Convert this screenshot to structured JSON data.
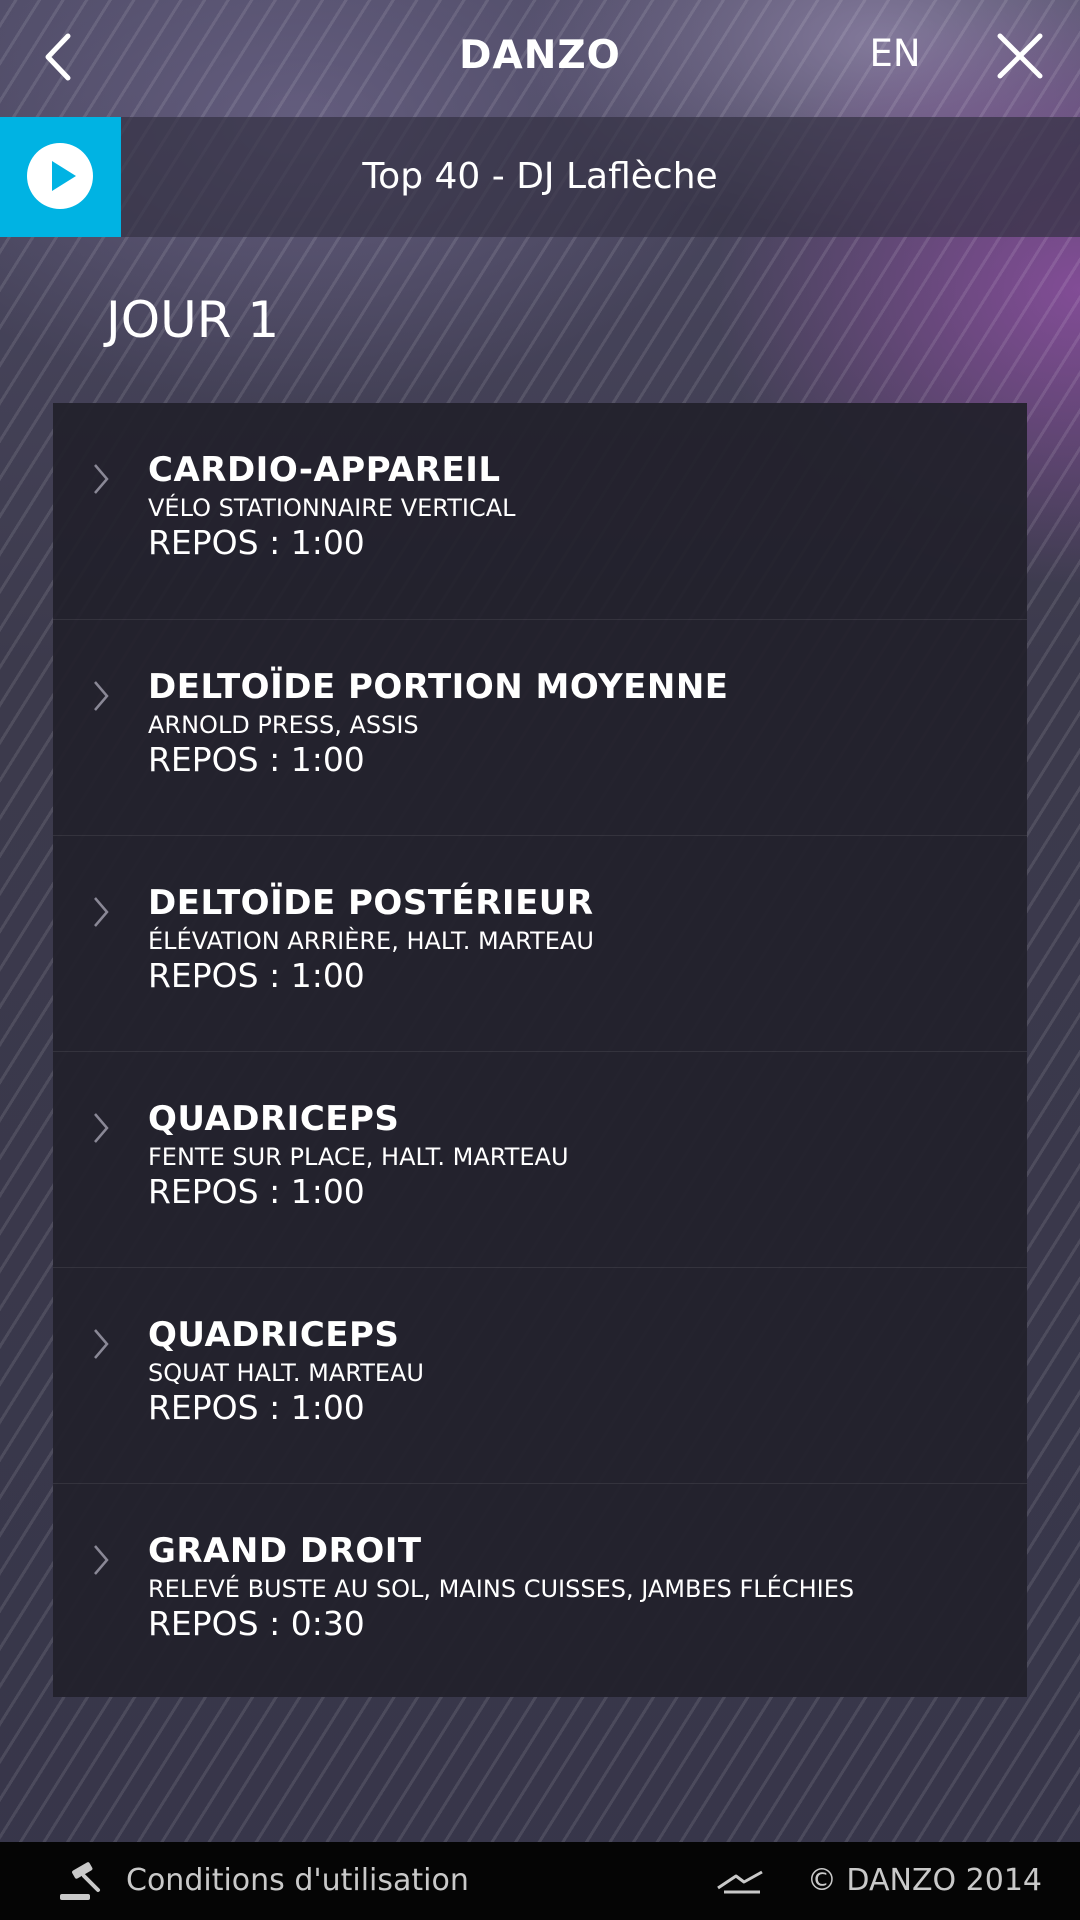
{
  "header": {
    "title": "DANZO",
    "language": "EN",
    "back_icon": "chevron-left-icon",
    "close_icon": "close-icon"
  },
  "player": {
    "track": "Top 40 - DJ Laflèche",
    "play_icon": "play-icon",
    "accent_color": "#00b3e3"
  },
  "day": {
    "title": "JOUR 1"
  },
  "exercises": [
    {
      "name": "CARDIO-APPAREIL",
      "subtitle": "VÉLO STATIONNAIRE VERTICAL",
      "rest": "REPOS : 1:00"
    },
    {
      "name": "DELTOÏDE PORTION MOYENNE",
      "subtitle": "ARNOLD PRESS, ASSIS",
      "rest": "REPOS : 1:00"
    },
    {
      "name": "DELTOÏDE POSTÉRIEUR",
      "subtitle": "ÉLÉVATION ARRIÈRE, HALT. MARTEAU",
      "rest": "REPOS : 1:00"
    },
    {
      "name": "QUADRICEPS",
      "subtitle": "FENTE SUR PLACE, HALT. MARTEAU",
      "rest": "REPOS : 1:00"
    },
    {
      "name": "QUADRICEPS",
      "subtitle": "SQUAT HALT. MARTEAU",
      "rest": "REPOS : 1:00"
    },
    {
      "name": "GRAND DROIT",
      "subtitle": "RELEVÉ BUSTE AU SOL, MAINS CUISSES, JAMBES FLÉCHIES",
      "rest": "REPOS : 0:30"
    }
  ],
  "footer": {
    "terms": "Conditions d'utilisation",
    "copyright": "© DANZO 2014",
    "terms_icon": "gavel-icon",
    "brand_icon": "danzo-logo-icon"
  }
}
